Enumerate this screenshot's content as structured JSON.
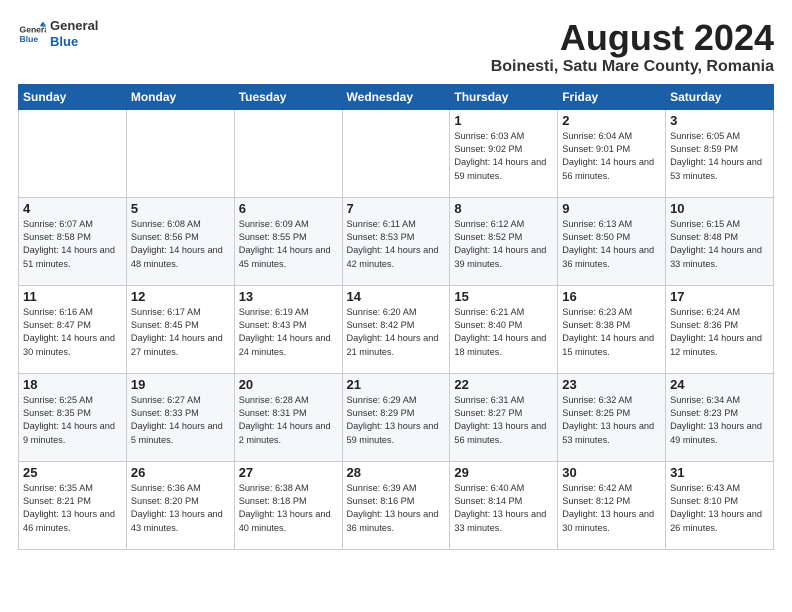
{
  "header": {
    "logo_line1": "General",
    "logo_line2": "Blue",
    "title": "August 2024",
    "subtitle": "Boinesti, Satu Mare County, Romania"
  },
  "weekdays": [
    "Sunday",
    "Monday",
    "Tuesday",
    "Wednesday",
    "Thursday",
    "Friday",
    "Saturday"
  ],
  "weeks": [
    [
      {
        "day": "",
        "info": ""
      },
      {
        "day": "",
        "info": ""
      },
      {
        "day": "",
        "info": ""
      },
      {
        "day": "",
        "info": ""
      },
      {
        "day": "1",
        "info": "Sunrise: 6:03 AM\nSunset: 9:02 PM\nDaylight: 14 hours\nand 59 minutes."
      },
      {
        "day": "2",
        "info": "Sunrise: 6:04 AM\nSunset: 9:01 PM\nDaylight: 14 hours\nand 56 minutes."
      },
      {
        "day": "3",
        "info": "Sunrise: 6:05 AM\nSunset: 8:59 PM\nDaylight: 14 hours\nand 53 minutes."
      }
    ],
    [
      {
        "day": "4",
        "info": "Sunrise: 6:07 AM\nSunset: 8:58 PM\nDaylight: 14 hours\nand 51 minutes."
      },
      {
        "day": "5",
        "info": "Sunrise: 6:08 AM\nSunset: 8:56 PM\nDaylight: 14 hours\nand 48 minutes."
      },
      {
        "day": "6",
        "info": "Sunrise: 6:09 AM\nSunset: 8:55 PM\nDaylight: 14 hours\nand 45 minutes."
      },
      {
        "day": "7",
        "info": "Sunrise: 6:11 AM\nSunset: 8:53 PM\nDaylight: 14 hours\nand 42 minutes."
      },
      {
        "day": "8",
        "info": "Sunrise: 6:12 AM\nSunset: 8:52 PM\nDaylight: 14 hours\nand 39 minutes."
      },
      {
        "day": "9",
        "info": "Sunrise: 6:13 AM\nSunset: 8:50 PM\nDaylight: 14 hours\nand 36 minutes."
      },
      {
        "day": "10",
        "info": "Sunrise: 6:15 AM\nSunset: 8:48 PM\nDaylight: 14 hours\nand 33 minutes."
      }
    ],
    [
      {
        "day": "11",
        "info": "Sunrise: 6:16 AM\nSunset: 8:47 PM\nDaylight: 14 hours\nand 30 minutes."
      },
      {
        "day": "12",
        "info": "Sunrise: 6:17 AM\nSunset: 8:45 PM\nDaylight: 14 hours\nand 27 minutes."
      },
      {
        "day": "13",
        "info": "Sunrise: 6:19 AM\nSunset: 8:43 PM\nDaylight: 14 hours\nand 24 minutes."
      },
      {
        "day": "14",
        "info": "Sunrise: 6:20 AM\nSunset: 8:42 PM\nDaylight: 14 hours\nand 21 minutes."
      },
      {
        "day": "15",
        "info": "Sunrise: 6:21 AM\nSunset: 8:40 PM\nDaylight: 14 hours\nand 18 minutes."
      },
      {
        "day": "16",
        "info": "Sunrise: 6:23 AM\nSunset: 8:38 PM\nDaylight: 14 hours\nand 15 minutes."
      },
      {
        "day": "17",
        "info": "Sunrise: 6:24 AM\nSunset: 8:36 PM\nDaylight: 14 hours\nand 12 minutes."
      }
    ],
    [
      {
        "day": "18",
        "info": "Sunrise: 6:25 AM\nSunset: 8:35 PM\nDaylight: 14 hours\nand 9 minutes."
      },
      {
        "day": "19",
        "info": "Sunrise: 6:27 AM\nSunset: 8:33 PM\nDaylight: 14 hours\nand 5 minutes."
      },
      {
        "day": "20",
        "info": "Sunrise: 6:28 AM\nSunset: 8:31 PM\nDaylight: 14 hours\nand 2 minutes."
      },
      {
        "day": "21",
        "info": "Sunrise: 6:29 AM\nSunset: 8:29 PM\nDaylight: 13 hours\nand 59 minutes."
      },
      {
        "day": "22",
        "info": "Sunrise: 6:31 AM\nSunset: 8:27 PM\nDaylight: 13 hours\nand 56 minutes."
      },
      {
        "day": "23",
        "info": "Sunrise: 6:32 AM\nSunset: 8:25 PM\nDaylight: 13 hours\nand 53 minutes."
      },
      {
        "day": "24",
        "info": "Sunrise: 6:34 AM\nSunset: 8:23 PM\nDaylight: 13 hours\nand 49 minutes."
      }
    ],
    [
      {
        "day": "25",
        "info": "Sunrise: 6:35 AM\nSunset: 8:21 PM\nDaylight: 13 hours\nand 46 minutes."
      },
      {
        "day": "26",
        "info": "Sunrise: 6:36 AM\nSunset: 8:20 PM\nDaylight: 13 hours\nand 43 minutes."
      },
      {
        "day": "27",
        "info": "Sunrise: 6:38 AM\nSunset: 8:18 PM\nDaylight: 13 hours\nand 40 minutes."
      },
      {
        "day": "28",
        "info": "Sunrise: 6:39 AM\nSunset: 8:16 PM\nDaylight: 13 hours\nand 36 minutes."
      },
      {
        "day": "29",
        "info": "Sunrise: 6:40 AM\nSunset: 8:14 PM\nDaylight: 13 hours\nand 33 minutes."
      },
      {
        "day": "30",
        "info": "Sunrise: 6:42 AM\nSunset: 8:12 PM\nDaylight: 13 hours\nand 30 minutes."
      },
      {
        "day": "31",
        "info": "Sunrise: 6:43 AM\nSunset: 8:10 PM\nDaylight: 13 hours\nand 26 minutes."
      }
    ]
  ]
}
